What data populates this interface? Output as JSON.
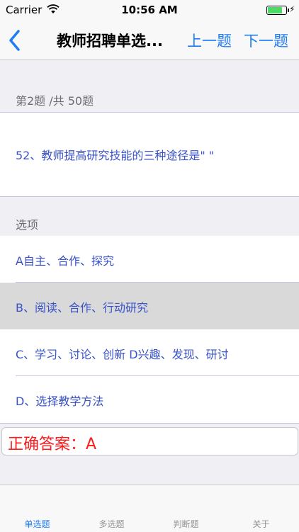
{
  "status_bar": {
    "carrier": "Carrier",
    "time": "10:56 AM"
  },
  "nav": {
    "title": "教师招聘单选...",
    "prev_label": "上一题",
    "next_label": "下一题"
  },
  "question": {
    "counter": "第2题 /共 50题",
    "text": "52、教师提高研究技能的三种途径是\"  \""
  },
  "options_header": "选项",
  "options": [
    {
      "label": "A自主、合作、探究",
      "selected": false
    },
    {
      "label": "B、阅读、合作、行动研究",
      "selected": true
    },
    {
      "label": "C、学习、讨论、创新 D兴趣、发现、研讨",
      "selected": false
    },
    {
      "label": "D、选择教学方法",
      "selected": false
    }
  ],
  "answer": "正确答案：A",
  "tabs": [
    {
      "label": "单选题",
      "active": true
    },
    {
      "label": "多选题",
      "active": false
    },
    {
      "label": "判断题",
      "active": false
    },
    {
      "label": "关于",
      "active": false
    }
  ],
  "colors": {
    "accent": "#1f7cf2",
    "option_text": "#3a53c8",
    "answer": "#ff1a1a",
    "battery": "#4cd964"
  },
  "battery_level": 0.78
}
